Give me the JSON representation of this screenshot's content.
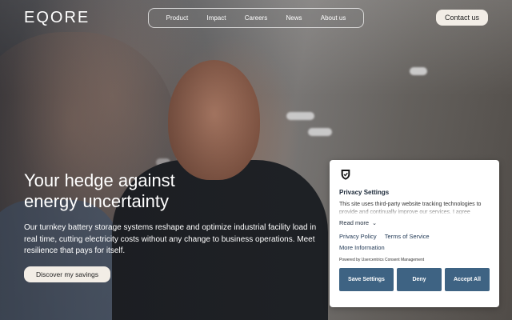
{
  "brand": {
    "logo": "EQORE"
  },
  "nav": {
    "items": [
      "Product",
      "Impact",
      "Careers",
      "News",
      "About us"
    ]
  },
  "header": {
    "contact_label": "Contact us"
  },
  "hero": {
    "title_line1": "Your hedge against",
    "title_line2": "energy uncertainty",
    "body": "Our turnkey battery storage systems reshape and optimize industrial facility load in real time, cutting electricity costs without any change to business operations. Meet resilience that pays for itself.",
    "cta_label": "Discover my savings"
  },
  "privacy": {
    "icon": "shield-check-icon",
    "title": "Privacy Settings",
    "text": "This site uses third-party website tracking technologies to provide and continually improve our services. I agree",
    "read_more": "Read more",
    "links": {
      "privacy_policy": "Privacy Policy",
      "terms": "Terms of Service",
      "more_info": "More Information"
    },
    "powered_by": "Powered by Usercentrics Consent Management",
    "buttons": {
      "save": "Save Settings",
      "deny": "Deny",
      "accept": "Accept All"
    },
    "colors": {
      "button": "#3e6383"
    }
  }
}
